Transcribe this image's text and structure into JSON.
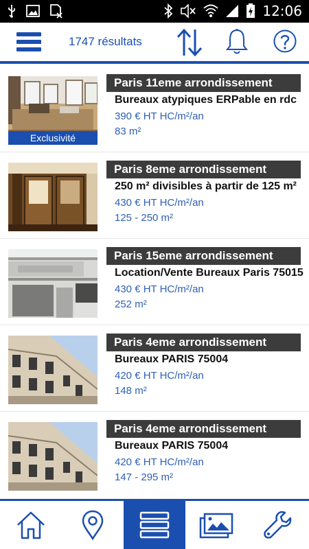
{
  "status_bar": {
    "time": "12:06",
    "icons": [
      "usb-icon",
      "image-icon",
      "sim-icon",
      "bluetooth-icon",
      "mute-icon",
      "wifi-icon",
      "signal-icon",
      "battery-icon"
    ]
  },
  "toolbar": {
    "results_label": "1747 résultats",
    "icons": [
      "menu-icon",
      "sort-icon",
      "bell-icon",
      "help-icon"
    ]
  },
  "listings": [
    {
      "district": "Paris 11eme arrondissement",
      "title": "Bureaux atypiques ERPable en rdc",
      "price": "390 € HT HC/m²/an",
      "area": "83 m²",
      "badge": "Exclusivité"
    },
    {
      "district": "Paris 8eme arrondissement",
      "title": "250 m² divisibles à partir de 125 m²",
      "price": "430 € HT HC/m²/an",
      "area": "125 - 250 m²"
    },
    {
      "district": "Paris 15eme arrondissement",
      "title": "Location/Vente Bureaux Paris 75015",
      "price": "430 € HT HC/m²/an",
      "area": "252 m²"
    },
    {
      "district": "Paris 4eme arrondissement",
      "title": "Bureaux PARIS 75004",
      "price": "420 € HT HC/m²/an",
      "area": "148 m²"
    },
    {
      "district": "Paris 4eme arrondissement",
      "title": "Bureaux PARIS 75004",
      "price": "420 € HT HC/m²/an",
      "area": "147 - 295 m²"
    }
  ],
  "bottom_nav": {
    "items": [
      "home-icon",
      "map-pin-icon",
      "list-icon",
      "gallery-icon",
      "wrench-icon"
    ],
    "active": "list-icon"
  },
  "colors": {
    "accent": "#1a4fb0",
    "district_bar": "#3c3c3c",
    "detail_text": "#2e5fb5"
  }
}
